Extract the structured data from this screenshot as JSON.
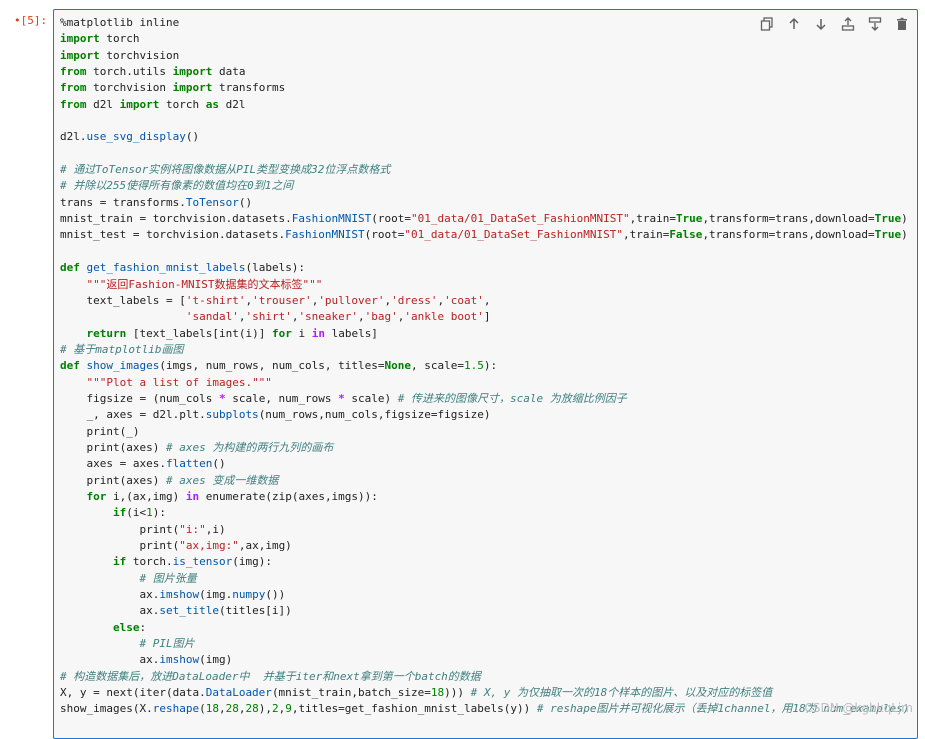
{
  "cell": {
    "prompt": "•[5]:",
    "toolbar": [
      {
        "name": "duplicate-icon"
      },
      {
        "name": "arrow-up-icon"
      },
      {
        "name": "arrow-down-icon"
      },
      {
        "name": "insert-above-icon"
      },
      {
        "name": "insert-below-icon"
      },
      {
        "name": "trash-icon"
      }
    ],
    "lines": [
      [
        [
          "p",
          "%matplotlib inline"
        ]
      ],
      [
        [
          "kw",
          "import"
        ],
        [
          "p",
          " torch"
        ]
      ],
      [
        [
          "kw",
          "import"
        ],
        [
          "p",
          " torchvision"
        ]
      ],
      [
        [
          "kw",
          "from"
        ],
        [
          "p",
          " torch.utils "
        ],
        [
          "kw",
          "import"
        ],
        [
          "p",
          " data"
        ]
      ],
      [
        [
          "kw",
          "from"
        ],
        [
          "p",
          " torchvision "
        ],
        [
          "kw",
          "import"
        ],
        [
          "p",
          " transforms"
        ]
      ],
      [
        [
          "kw",
          "from"
        ],
        [
          "p",
          " d2l "
        ],
        [
          "kw",
          "import"
        ],
        [
          "p",
          " torch "
        ],
        [
          "kw",
          "as"
        ],
        [
          "p",
          " d2l"
        ]
      ],
      [],
      [
        [
          "p",
          "d2l."
        ],
        [
          "fn",
          "use_svg_display"
        ],
        [
          "p",
          "()"
        ]
      ],
      [],
      [
        [
          "cm",
          "# 通过ToTensor实例将图像数据从PIL类型变换成32位浮点数格式"
        ]
      ],
      [
        [
          "cm",
          "# 并除以255使得所有像素的数值均在0到1之间"
        ]
      ],
      [
        [
          "p",
          "trans = transforms."
        ],
        [
          "fn",
          "ToTensor"
        ],
        [
          "p",
          "()"
        ]
      ],
      [
        [
          "p",
          "mnist_train = torchvision.datasets."
        ],
        [
          "fn",
          "FashionMNIST"
        ],
        [
          "p",
          "(root="
        ],
        [
          "str",
          "\"01_data/01_DataSet_FashionMNIST\""
        ],
        [
          "p",
          ",train="
        ],
        [
          "kw",
          "True"
        ],
        [
          "p",
          ",transform=trans,download="
        ],
        [
          "kw",
          "True"
        ],
        [
          "p",
          ")"
        ]
      ],
      [
        [
          "p",
          "mnist_test = torchvision.datasets."
        ],
        [
          "fn",
          "FashionMNIST"
        ],
        [
          "p",
          "(root="
        ],
        [
          "str",
          "\"01_data/01_DataSet_FashionMNIST\""
        ],
        [
          "p",
          ",train="
        ],
        [
          "kw",
          "False"
        ],
        [
          "p",
          ",transform=trans,download="
        ],
        [
          "kw",
          "True"
        ],
        [
          "p",
          ")"
        ]
      ],
      [],
      [
        [
          "kw",
          "def"
        ],
        [
          "p",
          " "
        ],
        [
          "fn",
          "get_fashion_mnist_labels"
        ],
        [
          "p",
          "(labels):"
        ]
      ],
      [
        [
          "p",
          "    "
        ],
        [
          "str",
          "\"\"\"返回Fashion-MNIST数据集的文本标签\"\"\""
        ]
      ],
      [
        [
          "p",
          "    text_labels = ["
        ],
        [
          "str",
          "'t-shirt'"
        ],
        [
          "p",
          ","
        ],
        [
          "str",
          "'trouser'"
        ],
        [
          "p",
          ","
        ],
        [
          "str",
          "'pullover'"
        ],
        [
          "p",
          ","
        ],
        [
          "str",
          "'dress'"
        ],
        [
          "p",
          ","
        ],
        [
          "str",
          "'coat'"
        ],
        [
          "p",
          ","
        ]
      ],
      [
        [
          "p",
          "                   "
        ],
        [
          "str",
          "'sandal'"
        ],
        [
          "p",
          ","
        ],
        [
          "str",
          "'shirt'"
        ],
        [
          "p",
          ","
        ],
        [
          "str",
          "'sneaker'"
        ],
        [
          "p",
          ","
        ],
        [
          "str",
          "'bag'"
        ],
        [
          "p",
          ","
        ],
        [
          "str",
          "'ankle boot'"
        ],
        [
          "p",
          "]"
        ]
      ],
      [
        [
          "p",
          "    "
        ],
        [
          "kw",
          "return"
        ],
        [
          "p",
          " [text_labels[int(i)] "
        ],
        [
          "kw",
          "for"
        ],
        [
          "p",
          " i "
        ],
        [
          "op",
          "in"
        ],
        [
          "p",
          " labels]"
        ]
      ],
      [
        [
          "cm",
          "# 基于matplotlib画图"
        ]
      ],
      [
        [
          "kw",
          "def"
        ],
        [
          "p",
          " "
        ],
        [
          "fn",
          "show_images"
        ],
        [
          "p",
          "(imgs, num_rows, num_cols, titles="
        ],
        [
          "kw",
          "None"
        ],
        [
          "p",
          ", scale="
        ],
        [
          "num",
          "1.5"
        ],
        [
          "p",
          "):"
        ]
      ],
      [
        [
          "p",
          "    "
        ],
        [
          "str",
          "\"\"\"Plot a list of images.\"\"\""
        ]
      ],
      [
        [
          "p",
          "    figsize = (num_cols "
        ],
        [
          "op",
          "*"
        ],
        [
          "p",
          " scale, num_rows "
        ],
        [
          "op",
          "*"
        ],
        [
          "p",
          " scale) "
        ],
        [
          "cm",
          "# 传进来的图像尺寸，scale 为放缩比例因子"
        ]
      ],
      [
        [
          "p",
          "    _, axes = d2l.plt."
        ],
        [
          "fn",
          "subplots"
        ],
        [
          "p",
          "(num_rows,num_cols,figsize=figsize)"
        ]
      ],
      [
        [
          "p",
          "    print(_)"
        ]
      ],
      [
        [
          "p",
          "    print(axes) "
        ],
        [
          "cm",
          "# axes 为构建的两行九列的画布"
        ]
      ],
      [
        [
          "p",
          "    axes = axes."
        ],
        [
          "fn",
          "flatten"
        ],
        [
          "p",
          "()"
        ]
      ],
      [
        [
          "p",
          "    print(axes) "
        ],
        [
          "cm",
          "# axes 变成一维数据"
        ]
      ],
      [
        [
          "p",
          "    "
        ],
        [
          "kw",
          "for"
        ],
        [
          "p",
          " i,(ax,img) "
        ],
        [
          "op",
          "in"
        ],
        [
          "p",
          " enumerate(zip(axes,imgs)):"
        ]
      ],
      [
        [
          "p",
          "        "
        ],
        [
          "kw",
          "if"
        ],
        [
          "p",
          "(i<"
        ],
        [
          "num",
          "1"
        ],
        [
          "p",
          "):"
        ]
      ],
      [
        [
          "p",
          "            print("
        ],
        [
          "str",
          "\"i:\""
        ],
        [
          "p",
          ",i)"
        ]
      ],
      [
        [
          "p",
          "            print("
        ],
        [
          "str",
          "\"ax,img:\""
        ],
        [
          "p",
          ",ax,img)"
        ]
      ],
      [
        [
          "p",
          "        "
        ],
        [
          "kw",
          "if"
        ],
        [
          "p",
          " torch."
        ],
        [
          "fn",
          "is_tensor"
        ],
        [
          "p",
          "(img):"
        ]
      ],
      [
        [
          "p",
          "            "
        ],
        [
          "cm",
          "# 图片张量"
        ]
      ],
      [
        [
          "p",
          "            ax."
        ],
        [
          "fn",
          "imshow"
        ],
        [
          "p",
          "(img."
        ],
        [
          "fn",
          "numpy"
        ],
        [
          "p",
          "())"
        ]
      ],
      [
        [
          "p",
          "            ax."
        ],
        [
          "fn",
          "set_title"
        ],
        [
          "p",
          "(titles[i])"
        ]
      ],
      [
        [
          "p",
          "        "
        ],
        [
          "kw",
          "else"
        ],
        [
          "p",
          ":"
        ]
      ],
      [
        [
          "p",
          "            "
        ],
        [
          "cm",
          "# PIL图片"
        ]
      ],
      [
        [
          "p",
          "            ax."
        ],
        [
          "fn",
          "imshow"
        ],
        [
          "p",
          "(img)"
        ]
      ],
      [
        [
          "cm",
          "# 构造数据集后，放进DataLoader中  并基于iter和next拿到第一个batch的数据"
        ]
      ],
      [
        [
          "p",
          "X, y = next(iter(data."
        ],
        [
          "fn",
          "DataLoader"
        ],
        [
          "p",
          "(mnist_train,batch_size="
        ],
        [
          "num",
          "18"
        ],
        [
          "p",
          ")))"
        ],
        [
          "p",
          " "
        ],
        [
          "cm",
          "# X, y 为仅抽取一次的18个样本的图片、以及对应的标签值"
        ]
      ],
      [
        [
          "p",
          "show_images(X."
        ],
        [
          "fn",
          "reshape"
        ],
        [
          "p",
          "("
        ],
        [
          "num",
          "18"
        ],
        [
          "p",
          ","
        ],
        [
          "num",
          "28"
        ],
        [
          "p",
          ","
        ],
        [
          "num",
          "28"
        ],
        [
          "p",
          "),"
        ],
        [
          "num",
          "2"
        ],
        [
          "p",
          ","
        ],
        [
          "num",
          "9"
        ],
        [
          "p",
          ",titles=get_fashion_mnist_labels(y)) "
        ],
        [
          "cm",
          "# reshape图片并可视化展示（丢掉1channel，用18为 num_examples)"
        ]
      ]
    ]
  },
  "watermark": "CSDN @kgbkqLjm"
}
